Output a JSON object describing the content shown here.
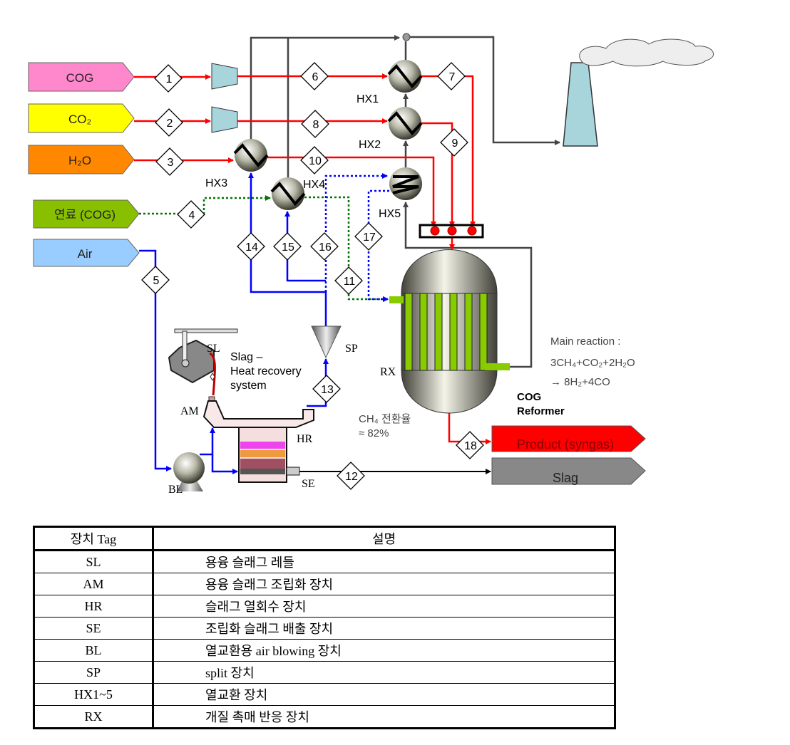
{
  "feeds": {
    "cog": {
      "label": "COG",
      "color": "#ff88cc"
    },
    "co2": {
      "label": "CO₂",
      "color": "#ffff00"
    },
    "h2o": {
      "label": "H₂O",
      "color": "#ff8800"
    },
    "fuel": {
      "label": "연료 (COG)",
      "color": "#88c000"
    },
    "air": {
      "label": "Air",
      "color": "#99ccff"
    }
  },
  "products": {
    "syngas": {
      "label": "Product (syngas)",
      "color": "#ff0000"
    },
    "slag": {
      "label": "Slag",
      "color": "#888888"
    }
  },
  "streams": [
    "1",
    "2",
    "3",
    "4",
    "5",
    "6",
    "7",
    "8",
    "9",
    "10",
    "11",
    "12",
    "13",
    "14",
    "15",
    "16",
    "17",
    "18"
  ],
  "equipment_labels": {
    "hx1": "HX1",
    "hx2": "HX2",
    "hx3": "HX3",
    "hx4": "HX4",
    "hx5": "HX5",
    "sl": "SL",
    "sp": "SP",
    "rx": "RX",
    "am": "AM",
    "hr": "HR",
    "se": "SE",
    "bl": "BL"
  },
  "annotations": {
    "slag_system": [
      "Slag –",
      "Heat recovery",
      "system"
    ],
    "main_reaction_title": "Main reaction :",
    "main_reaction_line1": "3CH₄+CO₂+2H₂O",
    "main_reaction_line2": "→ 8H₂+4CO",
    "reformer": [
      "COG",
      "Reformer"
    ],
    "conversion_line1": "CH₄ 전환율",
    "conversion_line2": "≈ 82%"
  },
  "line_colors": {
    "hot_feed": "#ff0000",
    "air": "#0000ff",
    "fuel": "#007700",
    "flue": "#444444",
    "slag": "#000000",
    "tubes": "#88cc00"
  },
  "table": {
    "headers": [
      "장치 Tag",
      "설명"
    ],
    "rows": [
      {
        "tag": "SL",
        "desc": "용융 슬래그 레들"
      },
      {
        "tag": "AM",
        "desc": "용융 슬래그 조립화 장치"
      },
      {
        "tag": "HR",
        "desc": "슬래그 열회수 장치"
      },
      {
        "tag": "SE",
        "desc": "조립화 슬래그 배출 장치"
      },
      {
        "tag": "BL",
        "desc": "열교환용 air blowing 장치"
      },
      {
        "tag": "SP",
        "desc": "split 장치"
      },
      {
        "tag": "HX1~5",
        "desc": "열교환 장치"
      },
      {
        "tag": "RX",
        "desc": "개질 촉매 반응 장치"
      }
    ]
  }
}
